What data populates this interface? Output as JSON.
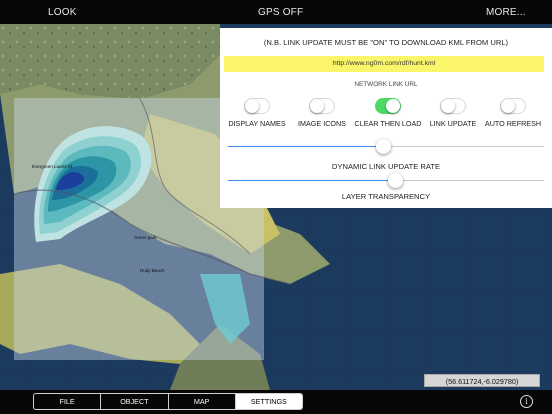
{
  "topbar": {
    "look": "LOOK",
    "gps": "GPS OFF",
    "more": "MORE..."
  },
  "map": {
    "labels": [
      "Evergreen Laurel St",
      "Green park",
      "Rudy Beach"
    ]
  },
  "panel": {
    "note": "(N.B. LINK UPDATE MUST BE \"ON\" TO DOWNLOAD KML FROM URL)",
    "url": "http://www.ng0m.com/rdf/hunt.kml",
    "url_label": "NETWORK LINK URL",
    "toggles": [
      {
        "label": "DISPLAY NAMES",
        "on": false
      },
      {
        "label": "IMAGE ICONS",
        "on": false
      },
      {
        "label": "CLEAR THEN LOAD",
        "on": true
      },
      {
        "label": "LINK UPDATE",
        "on": false
      },
      {
        "label": "AUTO REFRESH",
        "on": false
      }
    ],
    "sliders": [
      {
        "label": "DYNAMIC LINK UPDATE RATE",
        "value": 0.49
      },
      {
        "label": "LAYER TRANSPARENCY",
        "value": 0.53
      }
    ]
  },
  "coords": "(56.611724,-6.029780)",
  "tabs": [
    {
      "label": "FILE",
      "active": false
    },
    {
      "label": "OBJECT",
      "active": false
    },
    {
      "label": "MAP",
      "active": false
    },
    {
      "label": "SETTINGS",
      "active": true
    }
  ],
  "info_icon": "info-icon",
  "colors": {
    "toggle_on": "#4cd964",
    "slider_fill": "#3b8ce8",
    "url_highlight": "#fbf56a"
  }
}
